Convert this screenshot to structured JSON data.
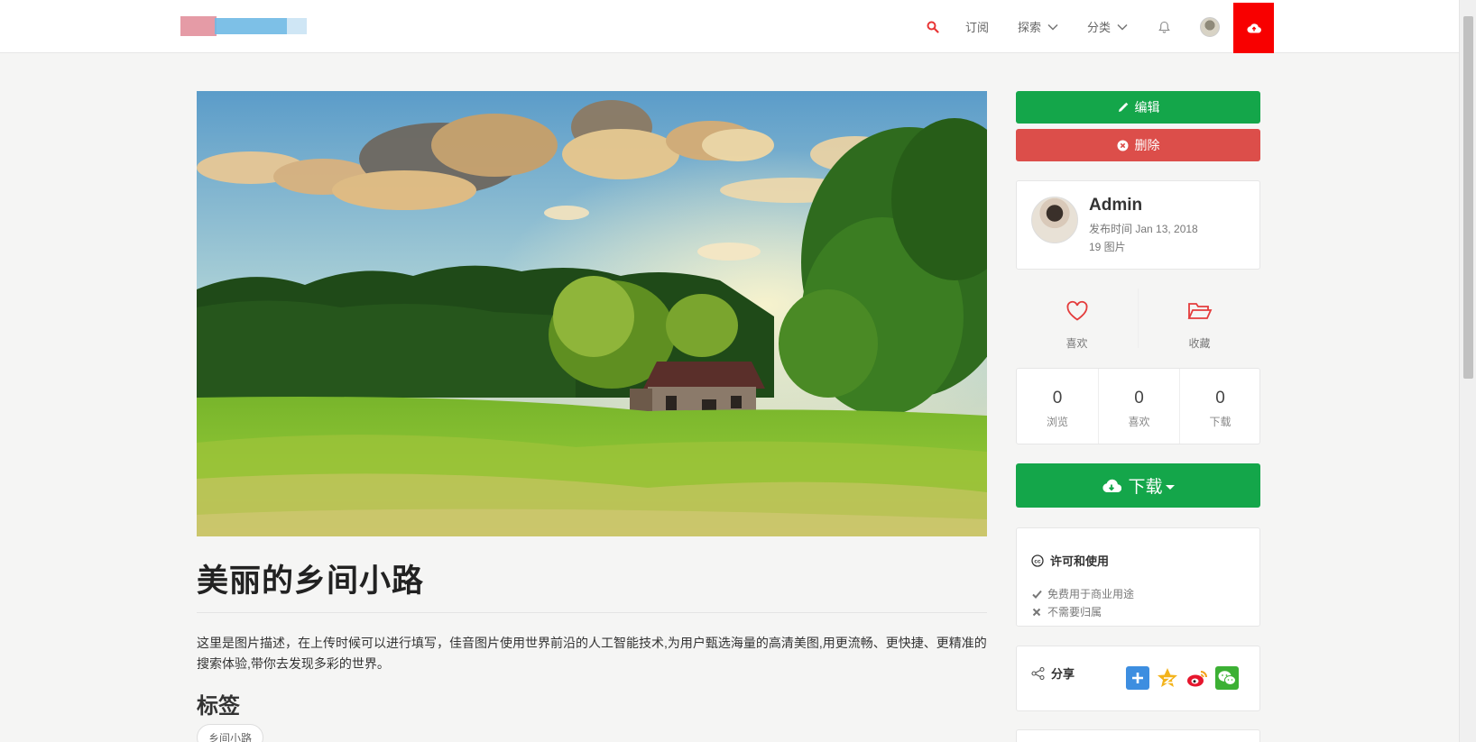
{
  "header": {
    "nav": {
      "subscribe": "订阅",
      "explore": "探索",
      "category": "分类"
    },
    "icons": {
      "search": "search-icon",
      "bell": "bell-icon",
      "upload": "cloud-upload-icon"
    },
    "colors": {
      "accent": "#f80000",
      "search_icon": "#e83535"
    }
  },
  "photo": {
    "title": "美丽的乡间小路",
    "description": "这里是图片描述，在上传时候可以进行填写，佳音图片使用世界前沿的人工智能技术,为用户甄选海量的高清美图,用更流畅、更快捷、更精准的搜索体验,带你去发现多彩的世界。",
    "tags_heading": "标签",
    "tags": [
      "乡间小路"
    ]
  },
  "actions": {
    "edit": "编辑",
    "delete": "删除",
    "download": "下载",
    "colors": {
      "green": "#14a64a",
      "red": "#dc4e4a"
    }
  },
  "author": {
    "name": "Admin",
    "published": "发布时间 Jan 13, 2018",
    "count": "19 图片"
  },
  "reactions": {
    "like": "喜欢",
    "favorite": "收藏"
  },
  "stats": [
    {
      "value": "0",
      "label": "浏览"
    },
    {
      "value": "0",
      "label": "喜欢"
    },
    {
      "value": "0",
      "label": "下载"
    }
  ],
  "license": {
    "title": "许可和使用",
    "items": [
      "免费用于商业用途",
      "不需要归属"
    ]
  },
  "share": {
    "title": "分享",
    "icons": [
      "add-share-icon",
      "star-share-icon",
      "weibo-icon",
      "wechat-icon"
    ]
  }
}
